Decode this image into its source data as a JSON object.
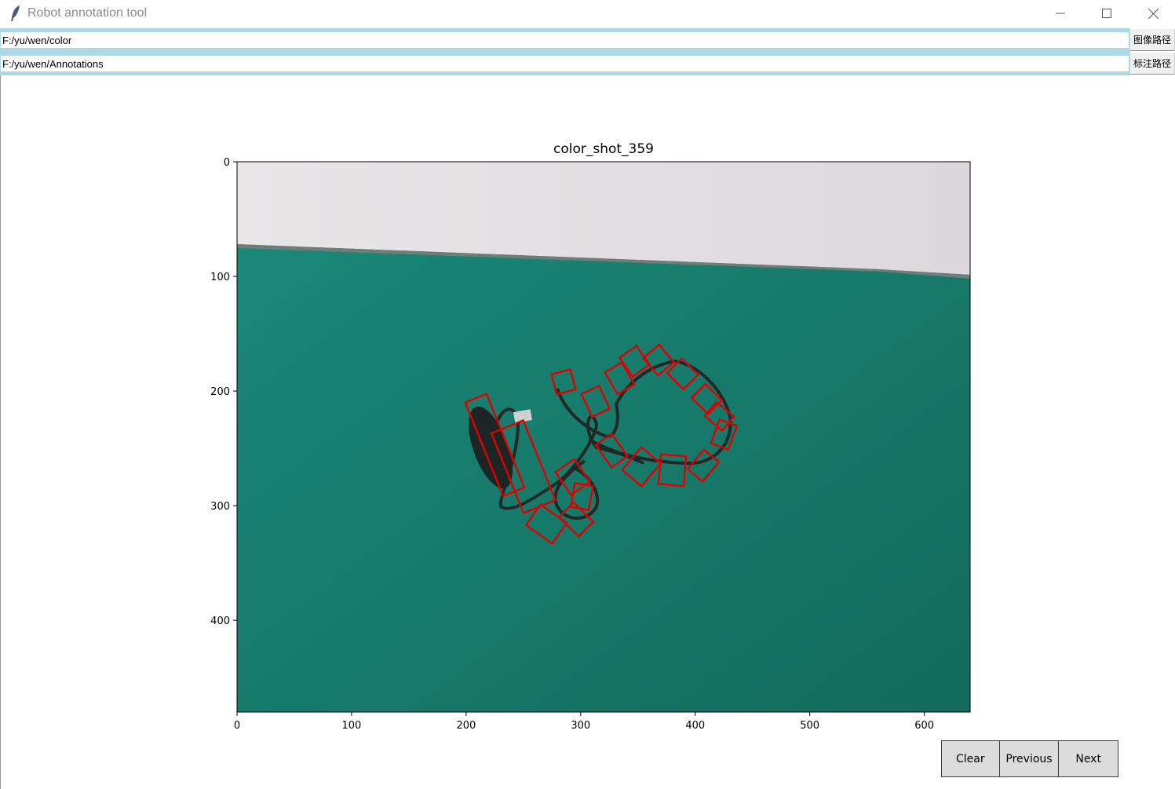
{
  "window": {
    "title": "Robot annotation tool",
    "icon": "feather-icon",
    "controls": [
      "minimize-icon",
      "maximize-icon",
      "close-icon"
    ]
  },
  "paths": {
    "image_path": "F:/yu/wen/color",
    "image_path_button": "图像路径",
    "annotation_path": "F:/yu/wen/Annotations",
    "annotation_path_button": "标注路径"
  },
  "plot": {
    "title": "color_shot_359",
    "x_ticks": [
      "0",
      "100",
      "200",
      "300",
      "400",
      "500",
      "600"
    ],
    "y_ticks": [
      "0",
      "100",
      "200",
      "300",
      "400"
    ],
    "xlim": [
      0,
      640
    ],
    "ylim": [
      480,
      0
    ],
    "annotation_color": "#e00000",
    "image_colors": {
      "wall": "#e6e2e4",
      "table": "#16806f",
      "cable": "#1f2a28"
    },
    "boxes": [
      {
        "cx": 225,
        "cy": 247,
        "w": 20,
        "h": 88,
        "angle": -22
      },
      {
        "cx": 250,
        "cy": 266,
        "w": 30,
        "h": 75,
        "angle": -22
      },
      {
        "cx": 285,
        "cy": 192,
        "w": 17,
        "h": 18,
        "angle": -15
      },
      {
        "cx": 313,
        "cy": 209,
        "w": 17,
        "h": 22,
        "angle": -25
      },
      {
        "cx": 334,
        "cy": 189,
        "w": 17,
        "h": 22,
        "angle": -30
      },
      {
        "cx": 347,
        "cy": 174,
        "w": 18,
        "h": 20,
        "angle": -35
      },
      {
        "cx": 368,
        "cy": 173,
        "w": 18,
        "h": 20,
        "angle": -40
      },
      {
        "cx": 389,
        "cy": 185,
        "w": 18,
        "h": 20,
        "angle": -45
      },
      {
        "cx": 410,
        "cy": 207,
        "w": 17,
        "h": 20,
        "angle": -45
      },
      {
        "cx": 421,
        "cy": 222,
        "w": 16,
        "h": 20,
        "angle": -50
      },
      {
        "cx": 425,
        "cy": 238,
        "w": 16,
        "h": 22,
        "angle": 20
      },
      {
        "cx": 407,
        "cy": 265,
        "w": 17,
        "h": 22,
        "angle": 40
      },
      {
        "cx": 380,
        "cy": 269,
        "w": 22,
        "h": 26,
        "angle": 5
      },
      {
        "cx": 353,
        "cy": 266,
        "w": 22,
        "h": 26,
        "angle": 40
      },
      {
        "cx": 327,
        "cy": 252,
        "w": 17,
        "h": 24,
        "angle": -35
      },
      {
        "cx": 293,
        "cy": 275,
        "w": 20,
        "h": 24,
        "angle": -35
      },
      {
        "cx": 301,
        "cy": 292,
        "w": 16,
        "h": 21,
        "angle": 10
      },
      {
        "cx": 296,
        "cy": 312,
        "w": 18,
        "h": 24,
        "angle": -45
      },
      {
        "cx": 270,
        "cy": 316,
        "w": 22,
        "h": 28,
        "angle": -55
      }
    ]
  },
  "buttons": {
    "clear": "Clear",
    "previous": "Previous",
    "next": "Next"
  }
}
